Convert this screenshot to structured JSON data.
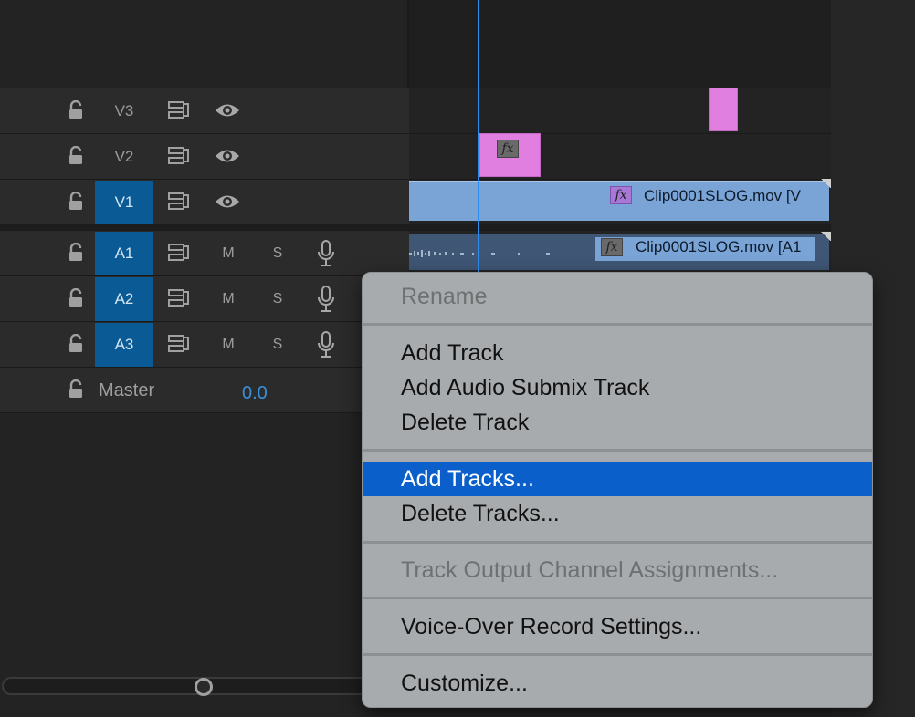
{
  "tracks": {
    "video": [
      {
        "name": "V3",
        "active": false
      },
      {
        "name": "V2",
        "active": false
      },
      {
        "name": "V1",
        "active": true
      }
    ],
    "audio": [
      {
        "name": "A1",
        "mute": "M",
        "solo": "S"
      },
      {
        "name": "A2",
        "mute": "M",
        "solo": "S"
      },
      {
        "name": "A3",
        "mute": "M",
        "solo": "S"
      }
    ],
    "master": {
      "label": "Master",
      "value": "0.0"
    }
  },
  "clips": {
    "fx_label": "fx",
    "video_clip": "Clip0001SLOG.mov [V",
    "audio_clip": "Clip0001SLOG.mov [A1"
  },
  "context_menu": {
    "items": [
      {
        "label": "Rename",
        "disabled": true
      },
      {
        "label": "Add Track"
      },
      {
        "label": "Add Audio Submix Track"
      },
      {
        "label": "Delete Track"
      },
      {
        "label": "Add Tracks...",
        "selected": true
      },
      {
        "label": "Delete Tracks..."
      },
      {
        "label": "Track Output Channel Assignments...",
        "disabled": true
      },
      {
        "label": "Voice-Over Record Settings..."
      },
      {
        "label": "Customize..."
      }
    ]
  },
  "colors": {
    "selection": "#0a5fca",
    "track_active": "#0a5a95",
    "playhead": "#2d8cf0",
    "pink_clip": "#e07fe0",
    "video_clip": "#7aa3d6",
    "audio_clip": "#3f5675",
    "master_value": "#3a8fd9"
  },
  "icons": {
    "lock": "lock-open-icon",
    "sync": "sync-lock-icon",
    "eye": "eye-icon",
    "mic": "microphone-icon",
    "fx": "fx-icon"
  }
}
